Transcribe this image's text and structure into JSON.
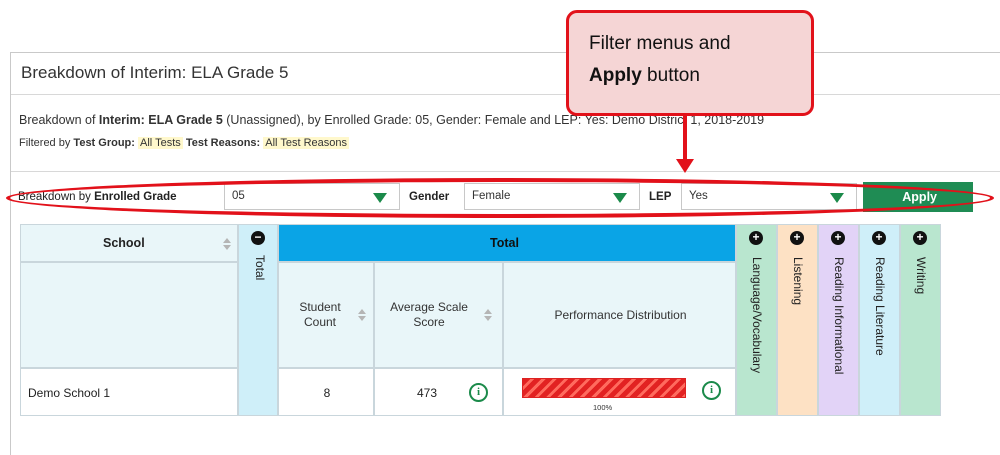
{
  "panel": {
    "title": "Breakdown of Interim: ELA Grade 5",
    "description": {
      "prefix": "Breakdown of ",
      "assessment": "Interim: ELA Grade 5",
      "rest": " (Unassigned), by Enrolled Grade: 05, Gender: Female and LEP: Yes: Demo District 1, 2018-2019"
    },
    "filtered": {
      "prefix": "Filtered by ",
      "test_group_label": "Test Group:",
      "test_group_value": "All Tests",
      "test_reasons_label": "Test Reasons:",
      "test_reasons_value": "All Test Reasons"
    }
  },
  "filters": {
    "breakdown_prefix": "Breakdown by ",
    "breakdown_label": "Enrolled Grade",
    "grade_value": "05",
    "gender_label": "Gender",
    "gender_value": "Female",
    "lep_label": "LEP",
    "lep_value": "Yes",
    "apply_label": "Apply"
  },
  "callout": {
    "line1": "Filter menus and",
    "line2_bold": "Apply",
    "line2_rest": " button"
  },
  "table": {
    "school_header": "School",
    "total_col": "Total",
    "total_header": "Total",
    "student_count_header": "Student Count",
    "avg_scale_header": "Average Scale Score",
    "perf_dist_header": "Performance Distribution",
    "row": {
      "school": "Demo School 1",
      "student_count": "8",
      "avg_scale_score": "473",
      "perf_percent": "100%",
      "perf_fraction": 1.0
    },
    "claims": [
      {
        "label": "Language/Vocabulary",
        "color": "#b9e6cf"
      },
      {
        "label": "Listening",
        "color": "#fde1c4"
      },
      {
        "label": "Reading Informational",
        "color": "#e2d3f7"
      },
      {
        "label": "Reading Literature",
        "color": "#cfeff9"
      },
      {
        "label": "Writing",
        "color": "#b9e6cf"
      }
    ],
    "colors": {
      "total_header_bg": "#0aa4e6",
      "header_bg": "#e9f6f9",
      "total_col_bg": "#cfeff9",
      "apply_bg": "#1f8c54",
      "callout_border": "#e2111a"
    }
  }
}
